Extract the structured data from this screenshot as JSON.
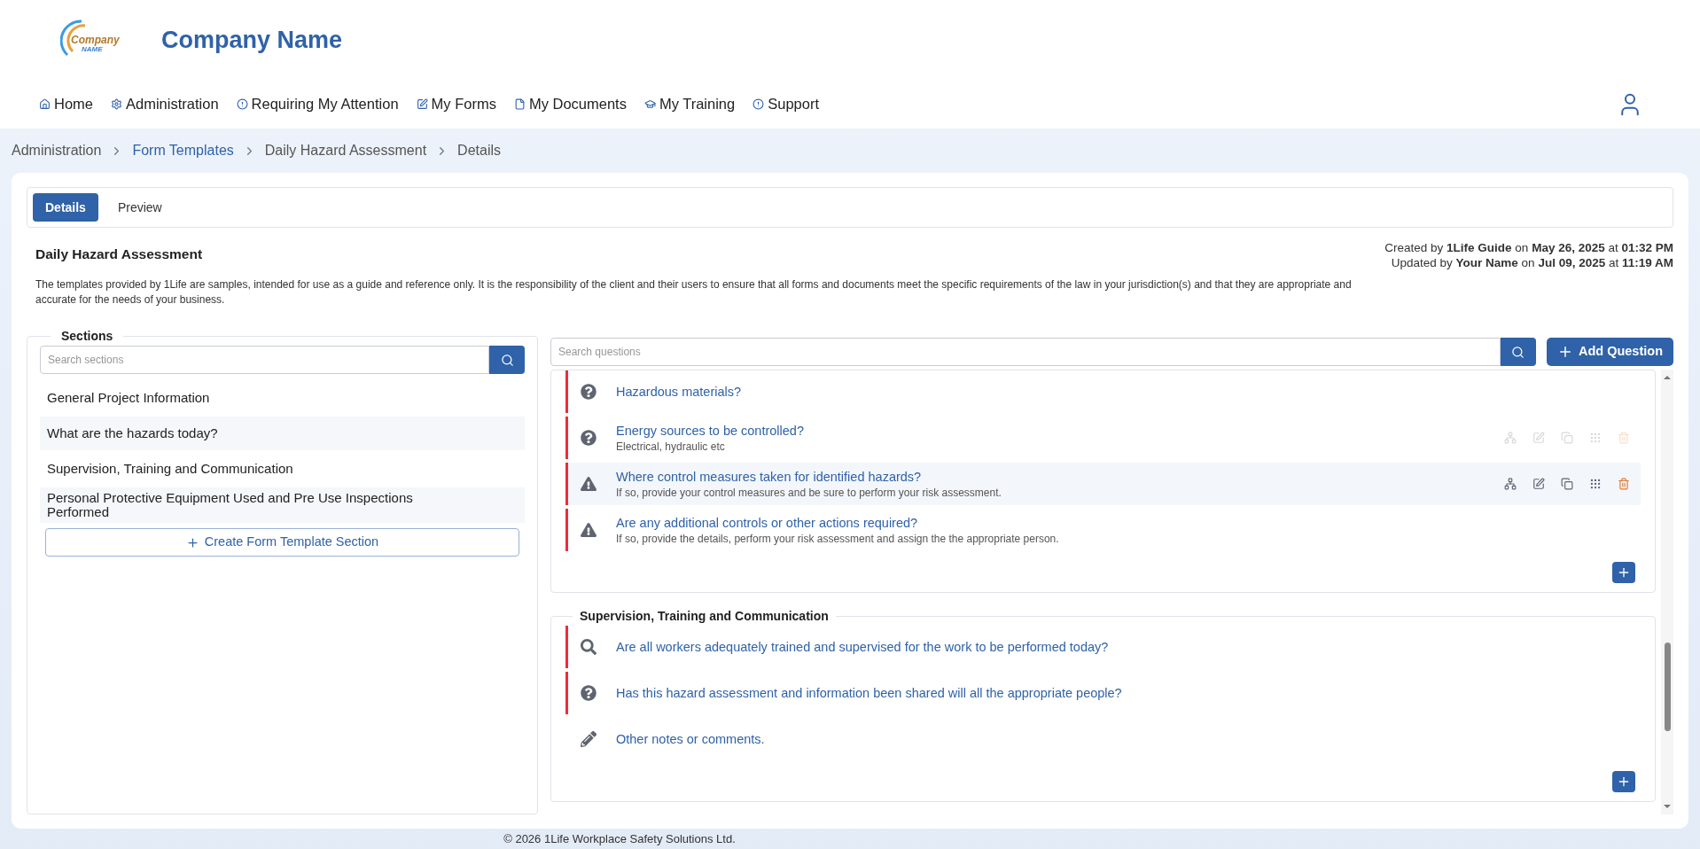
{
  "header": {
    "logo_text": "Company",
    "logo_subtext": "NAME",
    "company_name": "Company Name"
  },
  "nav": [
    {
      "label": "Home"
    },
    {
      "label": "Administration"
    },
    {
      "label": "Requiring My Attention"
    },
    {
      "label": "My Forms"
    },
    {
      "label": "My Documents"
    },
    {
      "label": "My Training"
    },
    {
      "label": "Support"
    }
  ],
  "breadcrumb": [
    {
      "label": "Administration",
      "link": false
    },
    {
      "label": "Form Templates",
      "link": true
    },
    {
      "label": "Daily Hazard Assessment",
      "link": false
    },
    {
      "label": "Details",
      "link": false
    }
  ],
  "tabs": [
    {
      "label": "Details",
      "selected": true
    },
    {
      "label": "Preview",
      "selected": false
    }
  ],
  "form": {
    "title": "Daily Hazard Assessment",
    "created": "Created by **1Life Guide** on **May 26, 2025** at **01:32 PM**",
    "updated": "Updated by **Your Name** on **Jul 09, 2025** at **11:19 AM**",
    "disclaimer": "The templates provided by 1Life are samples, intended for use as a guide and reference only. It is the responsibility of the client and their users to ensure that all forms and documents meet the specific requirements of the law in your jurisdiction(s) and that they are appropriate and accurate for the needs of your business."
  },
  "sections_panel": {
    "legend": "Sections",
    "search_placeholder": "Search sections",
    "create_button": "Create Form Template Section",
    "items": [
      {
        "label": "General Project Information"
      },
      {
        "label": "What are the hazards today?"
      },
      {
        "label": "Supervision, Training and Communication"
      },
      {
        "label": "Personal Protective Equipment Used and Pre Use Inspections Performed"
      }
    ]
  },
  "questions_panel": {
    "search_placeholder": "Search questions",
    "add_button": "Add Question",
    "groups": [
      {
        "questions": [
          {
            "kind": "question",
            "text": "Hazardous materials?",
            "required": true,
            "highlighted": false,
            "show_actions": false
          },
          {
            "kind": "question",
            "text": "Energy sources to be controlled?",
            "hint": "Electrical, hydraulic etc",
            "required": true,
            "highlighted": false,
            "show_actions": true,
            "actions_faded": true
          },
          {
            "kind": "warning",
            "text": "Where control measures taken for identified hazards?",
            "hint": "If so, provide your control measures and be sure to perform your risk assessment.",
            "required": true,
            "highlighted": true,
            "show_actions": true,
            "actions_faded": false
          },
          {
            "kind": "warning",
            "text": "Are any additional controls or other actions required?",
            "hint": "If so, provide the details, perform your risk assessment and assign the the appropriate person.",
            "required": true,
            "highlighted": false,
            "show_actions": false
          }
        ]
      },
      {
        "title": "Supervision, Training and Communication",
        "questions": [
          {
            "kind": "search",
            "text": "Are all workers adequately trained and supervised for the work to be performed today?",
            "required": true,
            "highlighted": false,
            "show_actions": false
          },
          {
            "kind": "question",
            "text": "Has this hazard assessment and information been shared will all the appropriate people?",
            "required": true,
            "highlighted": false,
            "show_actions": false
          },
          {
            "kind": "pencil",
            "text": "Other notes or comments.",
            "required": false,
            "highlighted": false,
            "show_actions": false
          }
        ]
      }
    ]
  },
  "footer": "© 2026 1Life Workplace Safety Solutions Ltd."
}
